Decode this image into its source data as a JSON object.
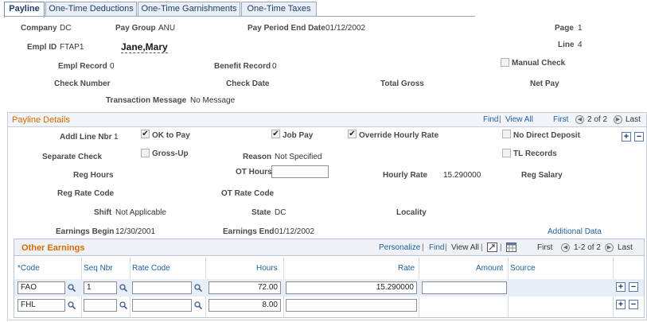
{
  "tabs": [
    "Payline",
    "One-Time Deductions",
    "One-Time Garnishments",
    "One-Time Taxes"
  ],
  "header": {
    "company_label": "Company",
    "company": "DC",
    "paygroup_label": "Pay Group",
    "paygroup": "ANU",
    "period_label": "Pay Period End Date",
    "period": "01/12/2002",
    "page_label": "Page",
    "page": "1",
    "line_label": "Line",
    "line": "4",
    "emplid_label": "Empl ID",
    "emplid": "FTAP1",
    "name": "Jane,Mary",
    "emplrec_label": "Empl Record",
    "emplrec": "0",
    "benefit_label": "Benefit Record",
    "benefit": "0",
    "manual_check_label": "Manual Check",
    "check_number_label": "Check Number",
    "check_date_label": "Check Date",
    "total_gross_label": "Total Gross",
    "net_pay_label": "Net Pay",
    "trans_msg_label": "Transaction Message",
    "trans_msg": "No Message"
  },
  "details": {
    "title": "Payline Details",
    "find": "Find",
    "view_all": "View All",
    "first": "First",
    "count": "2 of 2",
    "last": "Last",
    "addl_line_label": "Addl Line Nbr",
    "addl_line": "1",
    "ok_to_pay": "OK to Pay",
    "job_pay": "Job Pay",
    "override_hourly": "Override Hourly Rate",
    "no_direct_deposit": "No Direct Deposit",
    "separate_check_label": "Separate Check",
    "gross_up": "Gross-Up",
    "reason_label": "Reason",
    "reason": "Not Specified",
    "tl_records": "TL Records",
    "reg_hours_label": "Reg Hours",
    "ot_hours_label": "OT Hours",
    "hourly_rate_label": "Hourly Rate",
    "hourly_rate": "15.290000",
    "reg_salary_label": "Reg Salary",
    "reg_rate_code_label": "Reg Rate Code",
    "ot_rate_code_label": "OT Rate Code",
    "shift_label": "Shift",
    "shift": "Not Applicable",
    "state_label": "State",
    "state": "DC",
    "locality_label": "Locality",
    "earn_begin_label": "Earnings Begin",
    "earn_begin": "12/30/2001",
    "earn_end_label": "Earnings End",
    "earn_end": "01/12/2002",
    "additional_data": "Additional Data"
  },
  "earnings": {
    "title": "Other Earnings",
    "personalize": "Personalize",
    "find": "Find",
    "view_all": "View All",
    "first": "First",
    "count": "1-2 of 2",
    "last": "Last",
    "columns": [
      "*Code",
      "Seq Nbr",
      "Rate Code",
      "Hours",
      "Rate",
      "Amount",
      "Source"
    ],
    "rows": [
      {
        "code": "FAO",
        "seq": "1",
        "rate_code": "",
        "hours": "72.00",
        "rate": "15.290000",
        "amount": ""
      },
      {
        "code": "FHL",
        "seq": "",
        "rate_code": "",
        "hours": "8.00",
        "rate": "",
        "amount": ""
      }
    ]
  },
  "colors": {
    "accent": "#d96a00",
    "link": "#1e5f9e",
    "tab_border": "#9aa8bf"
  }
}
